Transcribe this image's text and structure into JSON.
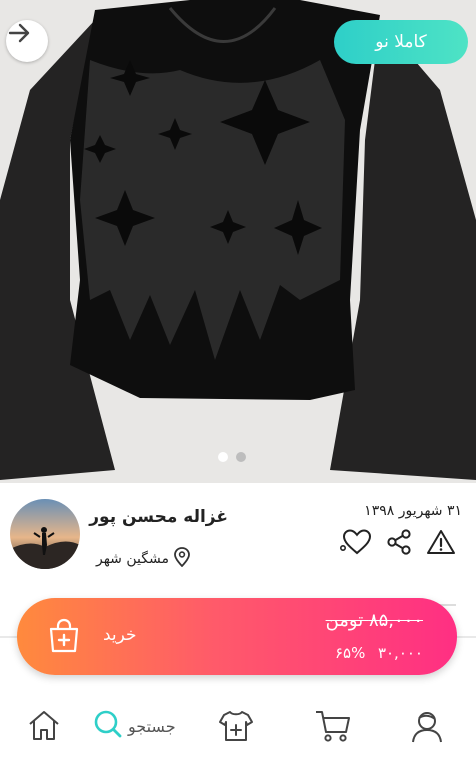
{
  "header": {
    "badge_label": "کاملا نو",
    "back_icon": "arrow-right-icon"
  },
  "carousel": {
    "total": 2,
    "active_index": 0,
    "colors": {
      "active": "#ffffff",
      "inactive": "#bdbdbd"
    }
  },
  "seller": {
    "name": "غزاله محسن پور",
    "city": "مشگین شهر",
    "date": "۳۱ شهریور ۱۳۹۸"
  },
  "actions": {
    "report_icon": "warning-icon",
    "share_icon": "share-icon",
    "like_icon": "heart-icon"
  },
  "purchase": {
    "buy_label": "خرید",
    "old_price": "۸۵,۰۰۰ تومن",
    "new_price": "۳۰,۰۰۰",
    "discount": "۶۵%",
    "colors": {
      "from": "#ff8a3d",
      "to": "#ff2f83"
    }
  },
  "nav": {
    "search_label": "جستجو",
    "items": [
      "home-icon",
      "search-icon",
      "add-product-icon",
      "cart-icon",
      "profile-icon"
    ],
    "accent": "#2ecfc8"
  }
}
